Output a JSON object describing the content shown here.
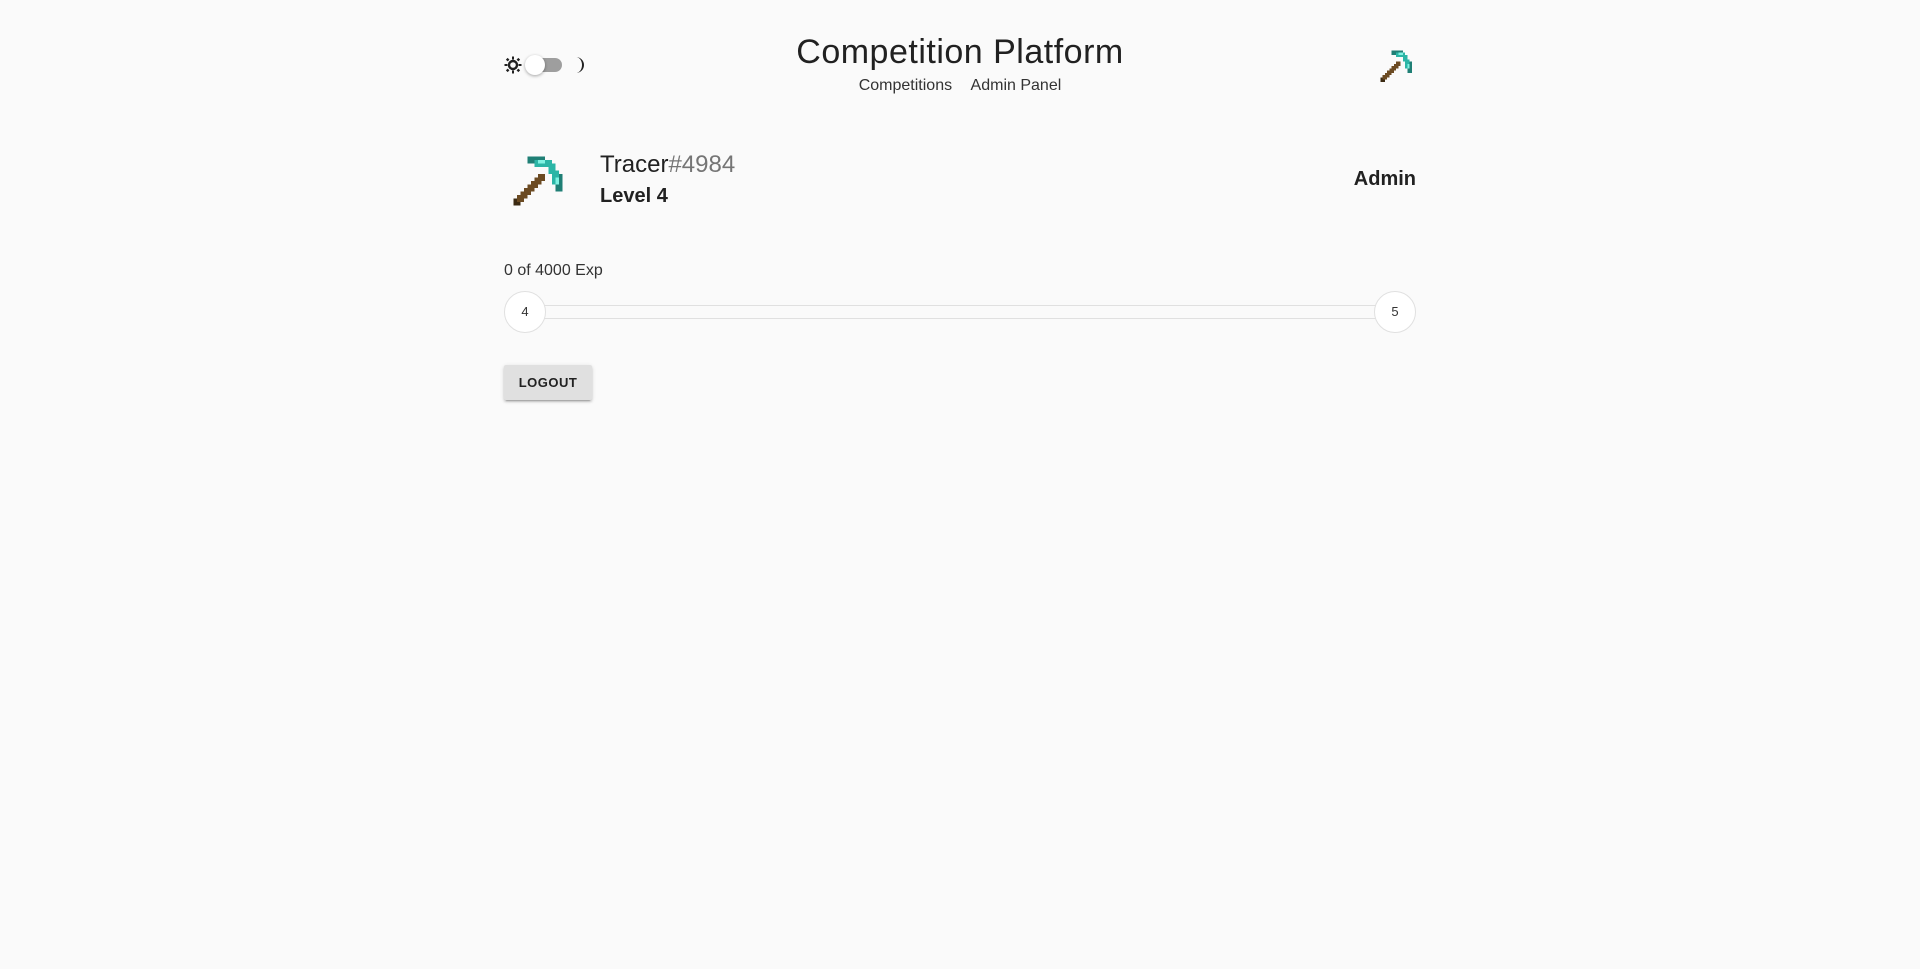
{
  "header": {
    "title": "Competition Platform",
    "nav": [
      {
        "label": "Competitions"
      },
      {
        "label": "Admin Panel"
      }
    ],
    "theme_toggle": {
      "state": "light"
    },
    "avatar_icon": "pickaxe-icon"
  },
  "profile": {
    "username": "Tracer",
    "discriminator": "#4984",
    "level_label": "Level 4",
    "role": "Admin",
    "avatar_icon": "pickaxe-icon"
  },
  "experience": {
    "label": "0 of 4000 Exp",
    "current": 0,
    "max": 4000,
    "progress_fraction": 0,
    "current_level": "4",
    "next_level": "5"
  },
  "actions": {
    "logout_label": "LOGOUT"
  },
  "colors": {
    "background": "#fafafa",
    "text": "#212121",
    "muted": "#757575",
    "button": "#e0e0e0",
    "pickaxe_head": "#2bb5a6",
    "pickaxe_handle": "#6b4a22"
  }
}
